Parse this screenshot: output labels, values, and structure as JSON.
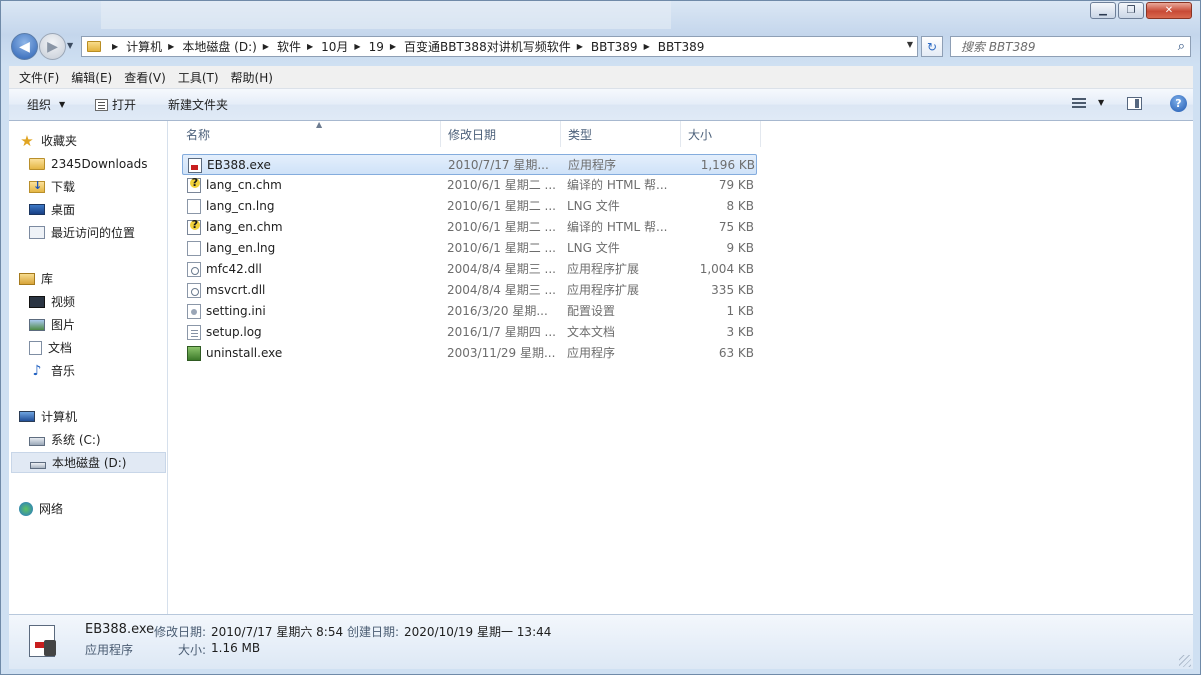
{
  "window": {
    "colors": {
      "accent": "#3169c6",
      "selection": "#cfe2f8",
      "chrome": "#c9d9ec"
    }
  },
  "address": {
    "breadcrumbs": [
      "计算机",
      "本地磁盘 (D:)",
      "软件",
      "10月",
      "19",
      "百变通BBT388对讲机写频软件",
      "BBT389",
      "BBT389"
    ]
  },
  "search": {
    "placeholder": "搜索 BBT389"
  },
  "menubar": {
    "items": [
      "文件(F)",
      "编辑(E)",
      "查看(V)",
      "工具(T)",
      "帮助(H)"
    ]
  },
  "commandbar": {
    "organize": "组织",
    "open": "打开",
    "new_folder": "新建文件夹"
  },
  "navpane": {
    "favorites": {
      "label": "收藏夹",
      "items": [
        "2345Downloads",
        "下载",
        "桌面",
        "最近访问的位置"
      ]
    },
    "libraries": {
      "label": "库",
      "items": [
        "视频",
        "图片",
        "文档",
        "音乐"
      ]
    },
    "computer": {
      "label": "计算机",
      "items": [
        "系统 (C:)",
        "本地磁盘 (D:)"
      ]
    },
    "network": {
      "label": "网络"
    }
  },
  "columns": {
    "name": "名称",
    "date": "修改日期",
    "type": "类型",
    "size": "大小"
  },
  "files": [
    {
      "name": "EB388.exe",
      "date": "2010/7/17 星期...",
      "type": "应用程序",
      "size": "1,196 KB",
      "icon": "exe-icon"
    },
    {
      "name": "lang_cn.chm",
      "date": "2010/6/1 星期二 ...",
      "type": "编译的 HTML 帮...",
      "size": "79 KB",
      "icon": "chm-icon"
    },
    {
      "name": "lang_cn.lng",
      "date": "2010/6/1 星期二 ...",
      "type": "LNG 文件",
      "size": "8 KB",
      "icon": "file-icon"
    },
    {
      "name": "lang_en.chm",
      "date": "2010/6/1 星期二 ...",
      "type": "编译的 HTML 帮...",
      "size": "75 KB",
      "icon": "chm-icon"
    },
    {
      "name": "lang_en.lng",
      "date": "2010/6/1 星期二 ...",
      "type": "LNG 文件",
      "size": "9 KB",
      "icon": "file-icon"
    },
    {
      "name": "mfc42.dll",
      "date": "2004/8/4 星期三 ...",
      "type": "应用程序扩展",
      "size": "1,004 KB",
      "icon": "dll-icon"
    },
    {
      "name": "msvcrt.dll",
      "date": "2004/8/4 星期三 ...",
      "type": "应用程序扩展",
      "size": "335 KB",
      "icon": "dll-icon"
    },
    {
      "name": "setting.ini",
      "date": "2016/3/20 星期...",
      "type": "配置设置",
      "size": "1 KB",
      "icon": "ini-icon"
    },
    {
      "name": "setup.log",
      "date": "2016/1/7 星期四 ...",
      "type": "文本文档",
      "size": "3 KB",
      "icon": "log-icon"
    },
    {
      "name": "uninstall.exe",
      "date": "2003/11/29 星期...",
      "type": "应用程序",
      "size": "63 KB",
      "icon": "uninstall-icon"
    }
  ],
  "details": {
    "filename": "EB388.exe",
    "modified_label": "修改日期:",
    "modified_value": "2010/7/17 星期六 8:54",
    "created_label": "创建日期:",
    "created_value": "2020/10/19 星期一 13:44",
    "type_value": "应用程序",
    "size_label": "大小:",
    "size_value": "1.16 MB"
  }
}
